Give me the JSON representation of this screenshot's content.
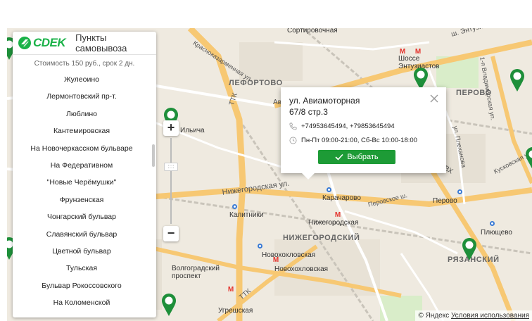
{
  "panel": {
    "logo_text": "CDEK",
    "title": "Пункты самовывоза",
    "subtitle": "Стоимость 150 руб., срок 2 дн.",
    "items": [
      "Жулеоино",
      "Лермонтовский пр-т.",
      "Люблино",
      "Кантемировская",
      "На Новочеркасском бульваре",
      "На Федеративном",
      "\"Новые Черёмушки\"",
      "Фрунзенская",
      "Чонгарский бульвар",
      "Славянский бульвар",
      "Цветной бульвар",
      "Тульская",
      "Бульвар Рокоссовского",
      "На Коломенской"
    ]
  },
  "popup": {
    "address_line1": "ул. Авиамоторная",
    "address_line2": "67/8 стр.3",
    "phones": "+74953645494, +79853645494",
    "hours": "Пн-Пт 09:00-21:00, Сб-Вс 10:00-18:00",
    "select_label": "Выбрать"
  },
  "map": {
    "districts": {
      "lefortovo": "ЛЕФОРТОВО",
      "perovo": "ПЕРОВО",
      "nizhegorodsky": "НИЖЕГОРОДСКИЙ",
      "ryazansky": "РЯЗАНСКИЙ"
    },
    "streets": {
      "sortirovochnaya": "Сортировочная",
      "entuziastov": "ш. Энтузиастов",
      "krasnokazarmennaya": "Красноказарменная ул.",
      "shosse_entuziastov": "Шоссе Энтузиастов",
      "ttk": "ТТК",
      "ilyicha": "Ильича",
      "nizhegorodskaya": "Нижегородская ул.",
      "karacharovo": "Карачарово",
      "perovskoe": "Перовское ш.",
      "kalitniki": "Калитники",
      "nizhegorodskaya_station": "Нижегородская",
      "perovo_station": "Перово",
      "plyushchevo": "Плющево",
      "novokhokhlovskaya": "Новохохловская",
      "novokhokhlovskaya2": "Новохохловская",
      "volgogradsky": "Волгоградский проспект",
      "ugreshskaya": "Угрешская",
      "ttk2": "ТТК",
      "vladimirskaya": "1-я Владимирская ул.",
      "plekhanova": "ул. Плеханова",
      "kuskovskaya": "Кусковская ул.",
      "svkh": "СВХ",
      "avenue": "Ав"
    },
    "copyright": "© Яндекс",
    "terms": "Условия использования"
  },
  "colors": {
    "brand_green": "#1ab248",
    "button_green": "#1d9b36",
    "pin_green": "#1e8f3a",
    "road_orange": "#f7c873",
    "metro_red": "#e4312b"
  }
}
